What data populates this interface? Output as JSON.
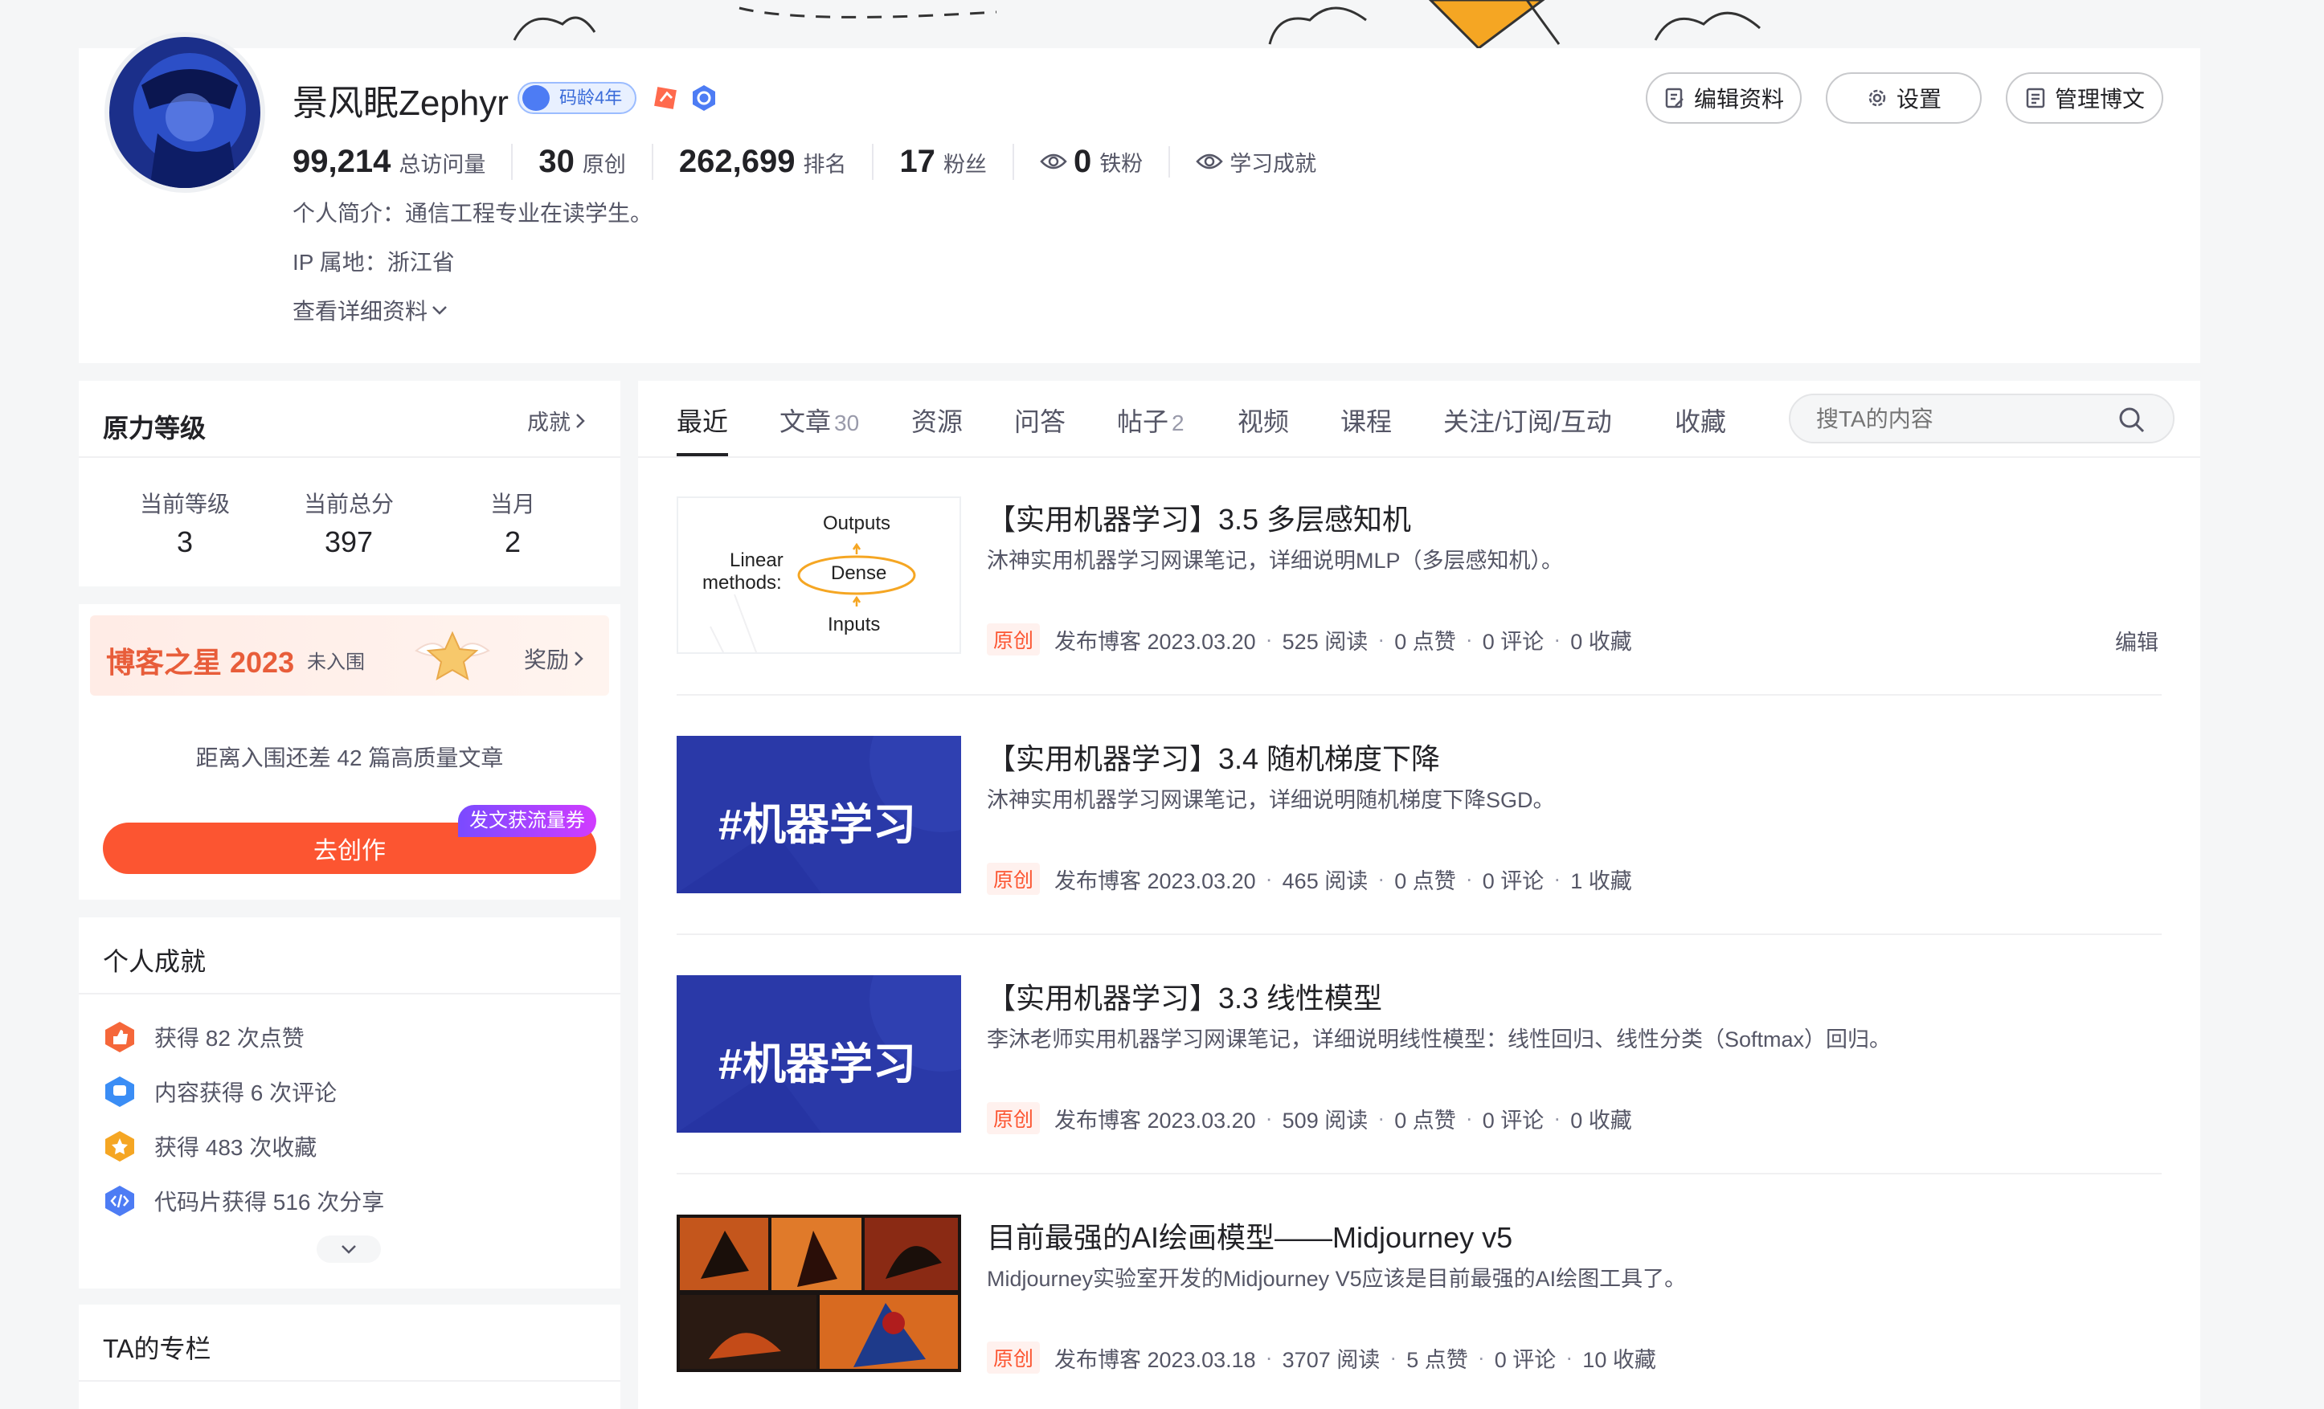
{
  "profile": {
    "name": "景风眠Zephyr",
    "code_age_badge": "码龄4年",
    "stats": [
      {
        "number": "99,214",
        "label": "总访问量"
      },
      {
        "number": "30",
        "label": "原创"
      },
      {
        "number": "262,699",
        "label": "排名"
      },
      {
        "number": "17",
        "label": "粉丝"
      },
      {
        "number": "0",
        "label": "铁粉"
      }
    ],
    "learning_label": "学习成就",
    "bio": "个人简介：通信工程专业在读学生。",
    "ip": "IP 属地：浙江省",
    "more_details": "查看详细资料"
  },
  "header_buttons": {
    "edit_profile": "编辑资料",
    "settings": "设置",
    "manage_posts": "管理博文"
  },
  "power": {
    "title": "原力等级",
    "achievements_link": "成就",
    "items": [
      {
        "label": "当前等级",
        "value": "3"
      },
      {
        "label": "当前总分",
        "value": "397"
      },
      {
        "label": "当月",
        "value": "2"
      }
    ]
  },
  "blog_star": {
    "title": "博客之星 2023",
    "status": "未入围",
    "reward_link": "奖励",
    "distance_text": "距离入围还差 42 篇高质量文章",
    "create_button": "去创作",
    "coupon_tag": "发文获流量券"
  },
  "personal_achievements": {
    "title": "个人成就",
    "items": [
      {
        "text": "获得 82 次点赞",
        "icon": "thumb-up-icon",
        "color": "#f5673a"
      },
      {
        "text": "内容获得 6 次评论",
        "icon": "comment-icon",
        "color": "#3a8df5"
      },
      {
        "text": "获得 483 次收藏",
        "icon": "star-icon",
        "color": "#f5a623"
      },
      {
        "text": "代码片获得 516 次分享",
        "icon": "code-share-icon",
        "color": "#4d7cf4"
      }
    ]
  },
  "columns": {
    "title": "TA的专栏"
  },
  "tabs": [
    {
      "label": "最近",
      "count": ""
    },
    {
      "label": "文章",
      "count": "30"
    },
    {
      "label": "资源",
      "count": ""
    },
    {
      "label": "问答",
      "count": ""
    },
    {
      "label": "帖子",
      "count": "2"
    },
    {
      "label": "视频",
      "count": ""
    },
    {
      "label": "课程",
      "count": ""
    },
    {
      "label": "关注/订阅/互动",
      "count": ""
    },
    {
      "label": "收藏",
      "count": ""
    }
  ],
  "search": {
    "placeholder": "搜TA的内容"
  },
  "mlp_thumb": {
    "outputs": "Outputs",
    "dense": "Dense",
    "inputs": "Inputs",
    "linear": "Linear",
    "methods": "methods:"
  },
  "ml_thumb_text": "#机器学习",
  "articles": [
    {
      "title": "【实用机器学习】3.5 多层感知机",
      "desc": "沐神实用机器学习网课笔记，详细说明MLP（多层感知机）。",
      "tag": "原创",
      "published": "发布博客 2023.03.20",
      "reads": "525 阅读",
      "likes": "0 点赞",
      "comments": "0 评论",
      "favorites": "0 收藏",
      "edit": "编辑"
    },
    {
      "title": "【实用机器学习】3.4 随机梯度下降",
      "desc": "沐神实用机器学习网课笔记，详细说明随机梯度下降SGD。",
      "tag": "原创",
      "published": "发布博客 2023.03.20",
      "reads": "465 阅读",
      "likes": "0 点赞",
      "comments": "0 评论",
      "favorites": "1 收藏"
    },
    {
      "title": "【实用机器学习】3.3 线性模型",
      "desc": "李沐老师实用机器学习网课笔记，详细说明线性模型：线性回归、线性分类（Softmax）回归。",
      "tag": "原创",
      "published": "发布博客 2023.03.20",
      "reads": "509 阅读",
      "likes": "0 点赞",
      "comments": "0 评论",
      "favorites": "0 收藏"
    },
    {
      "title": "目前最强的AI绘画模型——Midjourney v5",
      "desc": "Midjourney实验室开发的Midjourney V5应该是目前最强的AI绘图工具了。",
      "tag": "原创",
      "published": "发布博客 2023.03.18",
      "reads": "3707 阅读",
      "likes": "5 点赞",
      "comments": "0 评论",
      "favorites": "10 收藏"
    }
  ],
  "colors": {
    "brand": "#fc5531",
    "link": "#4d7cf4"
  }
}
